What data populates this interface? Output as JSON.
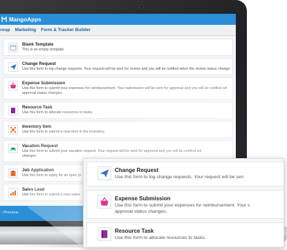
{
  "app": {
    "title": "MangoApps"
  },
  "menu": [
    {
      "label": "roup"
    },
    {
      "label": "Marketing"
    },
    {
      "label": "Form & Tracker Builder"
    }
  ],
  "templates": [
    {
      "icon": "blank-template-icon",
      "title": "Blank Template",
      "desc": [
        "This is an empty template"
      ]
    },
    {
      "icon": "paper-plane-icon",
      "title": "Change Request",
      "desc": [
        "Use this form to log change requests. Your request will be sent for review and you will be notified when the review status change"
      ]
    },
    {
      "icon": "basket-icon",
      "title": "Expense Submission",
      "desc": [
        "Use this form to submit your expenses for reimbursement. Your submission will be sent for approval and you will be notified wh",
        "approval status changes."
      ]
    },
    {
      "icon": "resource-task-icon",
      "title": "Resource Task",
      "desc": [
        "Use this form to allocate resources to tasks."
      ]
    },
    {
      "icon": "inventory-icon",
      "title": "Inventory Item",
      "desc": [
        "Use this form to submit a new item in the inventory."
      ]
    },
    {
      "icon": "vacation-icon",
      "title": "Vacation Request",
      "desc": [
        "Use this form to submit your vacation request. Your request will be sent for approval and you will be notified wh",
        "changes."
      ]
    },
    {
      "icon": "job-application-icon",
      "title": "Job Application",
      "desc": [
        "Use this form to apply for an open jo"
      ]
    },
    {
      "icon": "sales-lead-icon",
      "title": "Sales Lead",
      "desc": [
        "Use this form to submit a new sales"
      ]
    }
  ],
  "footer": {
    "previous_label": "‹ Previous"
  },
  "zoom": [
    {
      "icon": "paper-plane-icon",
      "title": "Change Request",
      "desc": [
        "Use this form to log change requests. Your request will be sen"
      ]
    },
    {
      "icon": "basket-icon",
      "title": "Expense Submission",
      "desc": [
        "Use this form to submit your expenses for reimbursement. Your s",
        "approval status changes."
      ]
    },
    {
      "icon": "resource-task-icon",
      "title": "Resource Task",
      "desc": [
        "Use this form to allocate resources to tasks."
      ]
    }
  ],
  "colors": {
    "brand_blue": "#2a8fd6",
    "plane": "#2f6fc4",
    "basket": "#e0338e",
    "task": "#8e2c9a",
    "inventory": "#e8702a",
    "vacation": "#1c9a8a",
    "job": "#e8702a"
  }
}
